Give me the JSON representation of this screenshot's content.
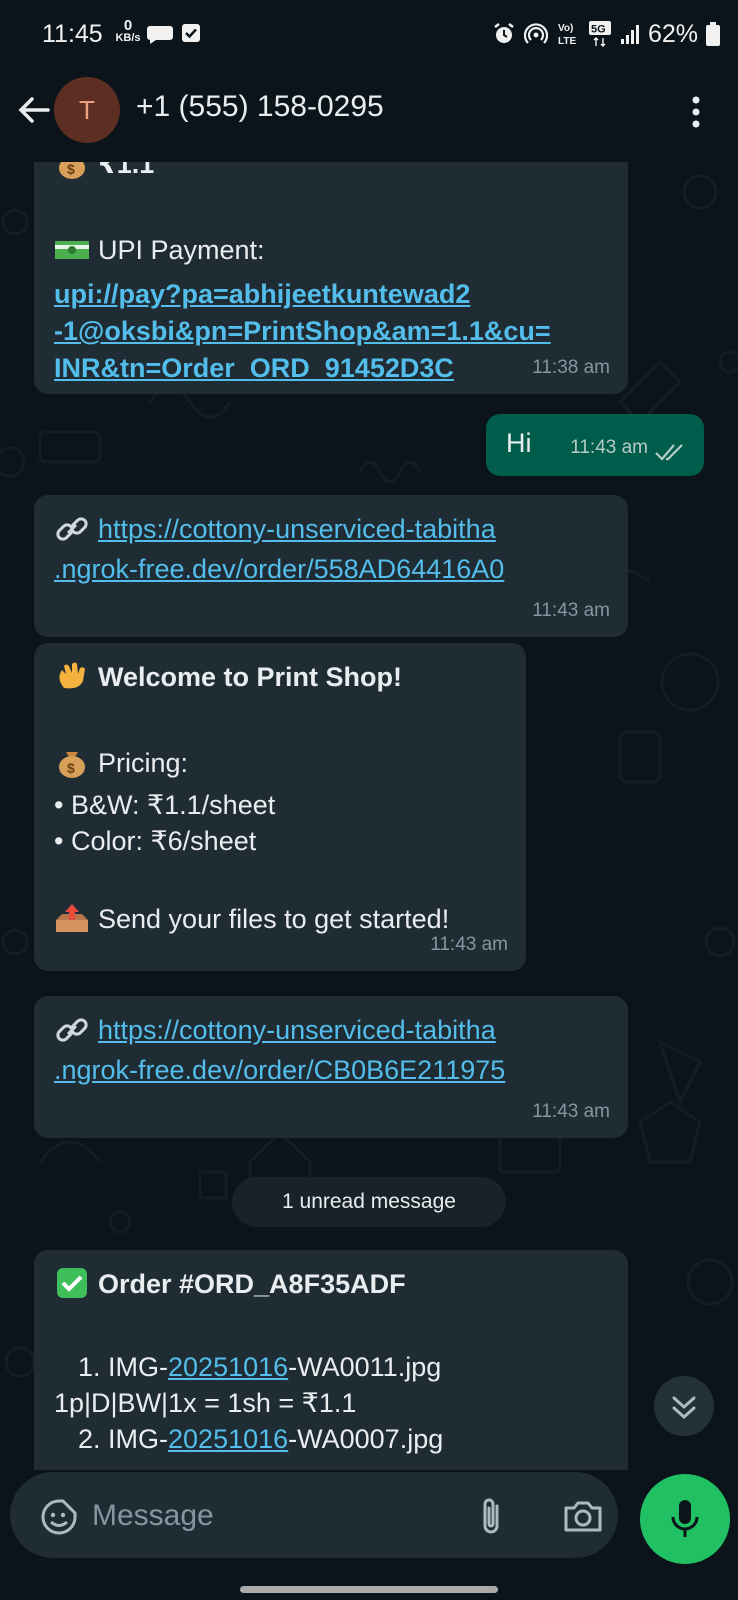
{
  "status_bar": {
    "time": "11:45",
    "net_speed_value": "0",
    "net_speed_unit": "KB/s",
    "network_lte": "Vo) LTE",
    "network_5g": "5G",
    "battery": "62%",
    "icons": [
      "chat-bubble-icon",
      "checkbox-icon",
      "alarm-icon",
      "hotspot-icon",
      "volte-icon",
      "5g-icon",
      "signal-icon",
      "battery-icon"
    ]
  },
  "header": {
    "avatar_initial": "T",
    "contact_name": "+1 (555) 158-0295"
  },
  "messages": [
    {
      "direction": "in",
      "partial_top": "₹1.1",
      "upi_label": "UPI Payment:",
      "upi_link_lines": [
        "upi://pay?pa=abhijeetkuntewad2",
        "-1@oksbi&pn=PrintShop&am=1.1&cu=",
        "INR&tn=Order_ORD_91452D3C"
      ],
      "time": "11:38 am"
    },
    {
      "direction": "out",
      "text": "Hi",
      "time": "11:43 am",
      "status": "read"
    },
    {
      "direction": "in",
      "link_lines": [
        "https://cottony-unserviced-tabitha",
        ".ngrok-free.dev/order/558AD64416A0"
      ],
      "time": "11:43 am"
    },
    {
      "direction": "in",
      "title": "Welcome to Print Shop!",
      "pricing_label": "Pricing:",
      "bw_line": "• B&W: ₹1.1/sheet",
      "color_line": "• Color: ₹6/sheet",
      "send_line": "Send your files to get started!",
      "time": "11:43 am"
    },
    {
      "direction": "in",
      "link_lines": [
        "https://cottony-unserviced-tabitha",
        ".ngrok-free.dev/order/CB0B6E211975"
      ],
      "time": "11:43 am"
    },
    {
      "direction": "in",
      "title": "Order #ORD_A8F35ADF",
      "item1_prefix": "1. IMG-",
      "item1_date": "20251016",
      "item1_suffix": "-WA0011.jpg",
      "item1_detail": "1p|D|BW|1x = 1sh = ₹1.1",
      "item2_prefix": "2. IMG-",
      "item2_date": "20251016",
      "item2_suffix": "-WA0007.jpg"
    }
  ],
  "unread_divider": "1 unread message",
  "input_bar": {
    "placeholder": "Message"
  },
  "colors": {
    "background": "#0b141a",
    "incoming_bubble": "#202c33",
    "outgoing_bubble": "#005c4b",
    "link": "#53bdeb",
    "mic_button": "#21c063",
    "read_ticks": "#b6ccc6"
  }
}
